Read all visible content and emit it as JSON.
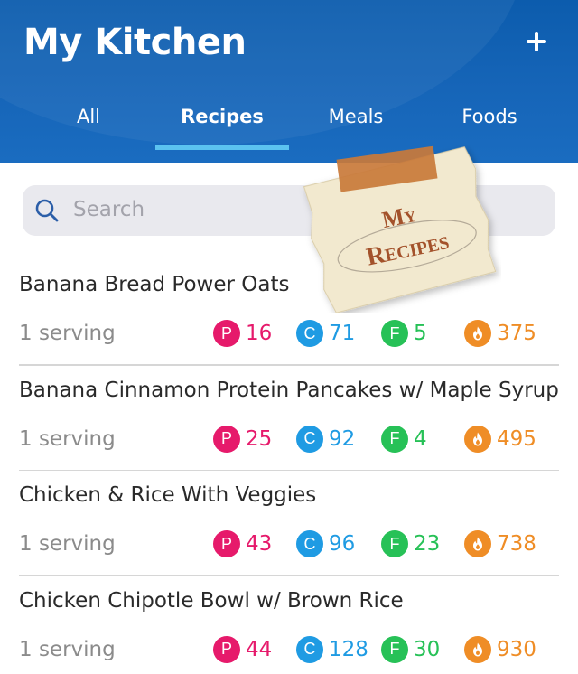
{
  "header": {
    "title": "My Kitchen",
    "add_icon": "plus-icon"
  },
  "tabs": [
    {
      "label": "All",
      "active": false
    },
    {
      "label": "Recipes",
      "active": true
    },
    {
      "label": "Meals",
      "active": false
    },
    {
      "label": "Foods",
      "active": false
    }
  ],
  "search": {
    "placeholder": "Search"
  },
  "sticker": {
    "line1": "My",
    "line2": "Recipes"
  },
  "recipes": [
    {
      "name": "Banana Bread Power Oats",
      "serving": "1 serving",
      "protein": "16",
      "carbs": "71",
      "fat": "5",
      "calories": "375"
    },
    {
      "name": "Banana Cinnamon Protein Pancakes w/ Maple Syrup",
      "serving": "1 serving",
      "protein": "25",
      "carbs": "92",
      "fat": "4",
      "calories": "495"
    },
    {
      "name": "Chicken & Rice With Veggies",
      "serving": "1 serving",
      "protein": "43",
      "carbs": "96",
      "fat": "23",
      "calories": "738"
    },
    {
      "name": "Chicken Chipotle Bowl w/ Brown Rice",
      "serving": "1 serving",
      "protein": "44",
      "carbs": "128",
      "fat": "30",
      "calories": "930"
    }
  ],
  "macro_letters": {
    "protein": "P",
    "carbs": "C",
    "fat": "F"
  },
  "colors": {
    "header": "#1665b8",
    "tab_underline": "#5bc3f0",
    "protein": "#e61a6b",
    "carbs": "#1f9be3",
    "fat": "#27c157",
    "calories": "#ef8d26"
  }
}
